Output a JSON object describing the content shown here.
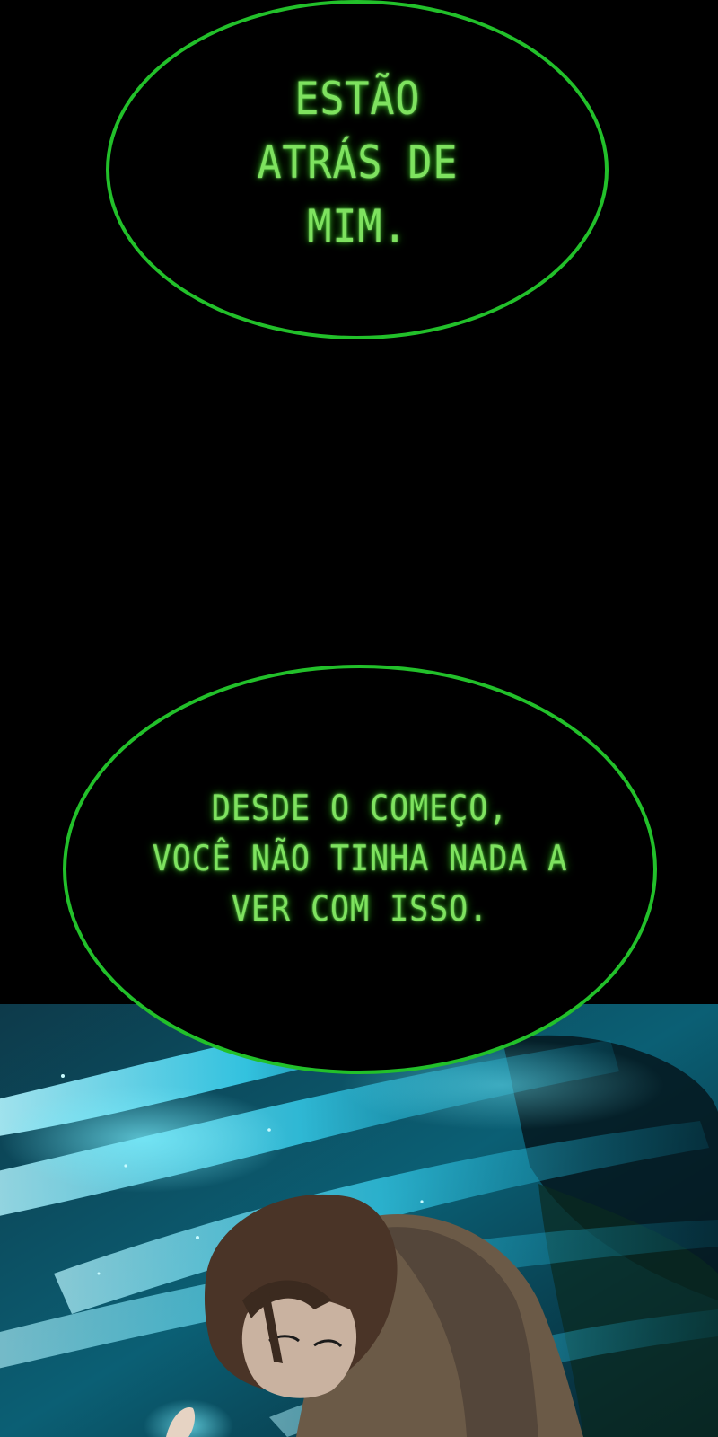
{
  "bubbles": {
    "top": {
      "text": "ESTÃO\nATRÁS DE\nMIM."
    },
    "bottom": {
      "text": "DESDE O COMEÇO,\nVOCÊ NÃO TINHA NADA A\nVER COM ISSO."
    }
  },
  "colors": {
    "background": "#000000",
    "bubble_border": "#22c02a",
    "bubble_text": "#7ee25f",
    "energy_cyan": "#39d6f5"
  },
  "art": {
    "description_icon": "character-illustration-icon"
  }
}
